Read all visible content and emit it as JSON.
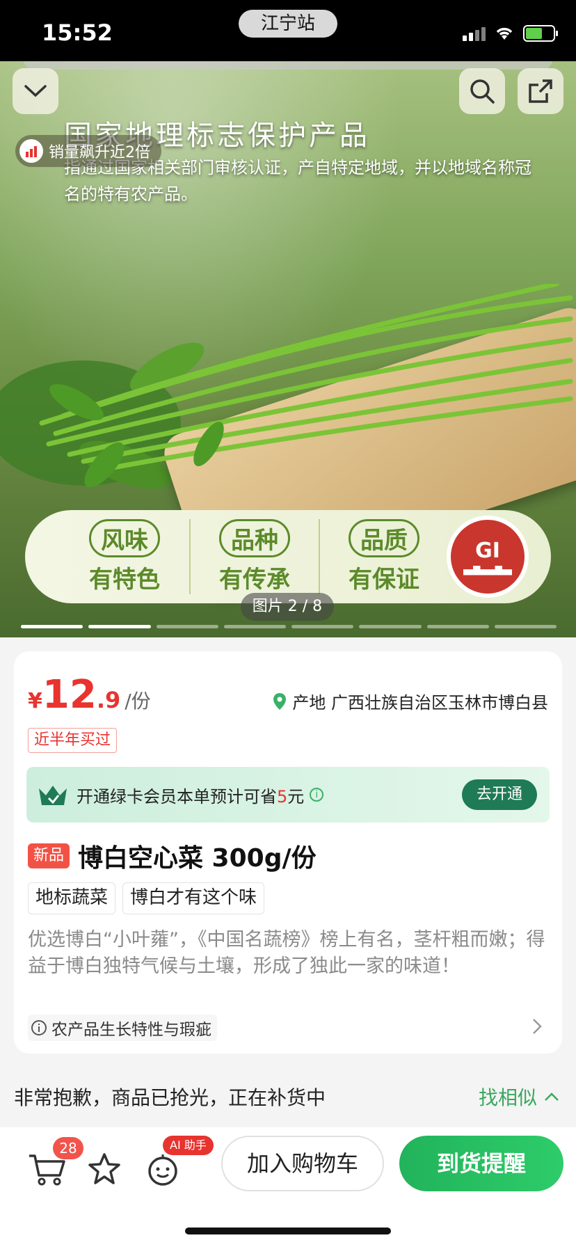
{
  "status": {
    "time": "15:52",
    "location": "江宁站"
  },
  "hero": {
    "banner_title": "国家地理标志保护产品",
    "banner_subtitle": "指通过国家相关部门审核认证，产自特定地域，并以地域名称冠名的特有农产品。",
    "sales_badge": "销量飙升近2倍",
    "features": [
      {
        "top": "风味",
        "bottom": "有特色"
      },
      {
        "top": "品种",
        "bottom": "有传承"
      },
      {
        "top": "品质",
        "bottom": "有保证"
      }
    ],
    "seal_text": "GI",
    "image_counter": "图片 2 / 8",
    "image_index": 2,
    "image_total": 8
  },
  "product": {
    "price_currency": "¥",
    "price_int": "12",
    "price_dec": ".9",
    "price_unit": "/份",
    "origin": "产地 广西壮族自治区玉林市博白县",
    "bought_tag": "近半年买过",
    "member_text_pre": "开通绿卡会员本单预计可省",
    "member_save": "5",
    "member_text_post": "元",
    "member_button": "去开通",
    "new_badge": "新品",
    "title": "博白空心菜 300g/份",
    "tags": [
      "地标蔬菜",
      "博白才有这个味"
    ],
    "description": "优选博白“小叶蕹”，《中国名蔬榜》榜上有名，茎杆粗而嫩；得益于博白独特气候与土壤，形成了独此一家的味道！",
    "info_link": "农产品生长特性与瑕疵"
  },
  "stock": {
    "message": "非常抱歉，商品已抢光，正在补货中",
    "similar_label": "找相似"
  },
  "actions": {
    "cart_count": "28",
    "ai_label": "AI 助手",
    "add_to_cart": "加入购物车",
    "notify": "到货提醒"
  },
  "colors": {
    "price_red": "#e8332f",
    "brand_green": "#2ecc6a",
    "member_button": "#1f7a56"
  }
}
